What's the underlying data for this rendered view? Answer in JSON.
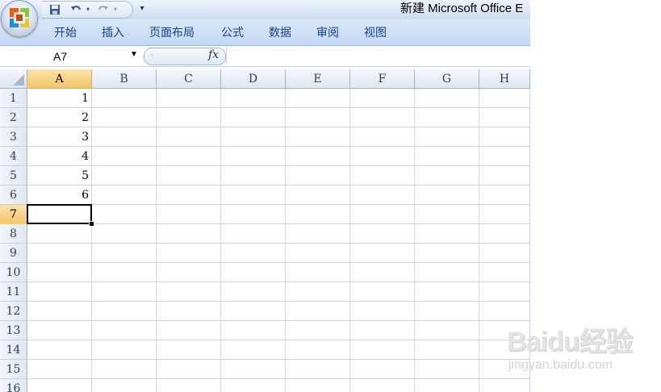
{
  "window": {
    "title": "新建 Microsoft Office E"
  },
  "ribbon": {
    "tabs": [
      "开始",
      "插入",
      "页面布局",
      "公式",
      "数据",
      "审阅",
      "视图"
    ]
  },
  "formula_bar": {
    "name_box": "A7",
    "fx_label": "fx",
    "formula_value": ""
  },
  "sheet": {
    "columns": [
      "A",
      "B",
      "C",
      "D",
      "E",
      "F",
      "G",
      "H"
    ],
    "rows": [
      "1",
      "2",
      "3",
      "4",
      "5",
      "6",
      "7",
      "8",
      "9",
      "10",
      "11",
      "12",
      "13",
      "14",
      "15",
      "16"
    ],
    "active_column": "A",
    "active_row": "7",
    "cells": [
      {
        "ref": "A1",
        "value": "1"
      },
      {
        "ref": "A2",
        "value": "2"
      },
      {
        "ref": "A3",
        "value": "3"
      },
      {
        "ref": "A4",
        "value": "4"
      },
      {
        "ref": "A5",
        "value": "5"
      },
      {
        "ref": "A6",
        "value": "6"
      }
    ]
  },
  "watermark": {
    "brand": "Baidu经验",
    "url": "jingyan.baidu.com"
  },
  "colors": {
    "ribbon_text": "#15428b",
    "header_active": "#f6c56a",
    "gridline": "#d0d7e5"
  }
}
